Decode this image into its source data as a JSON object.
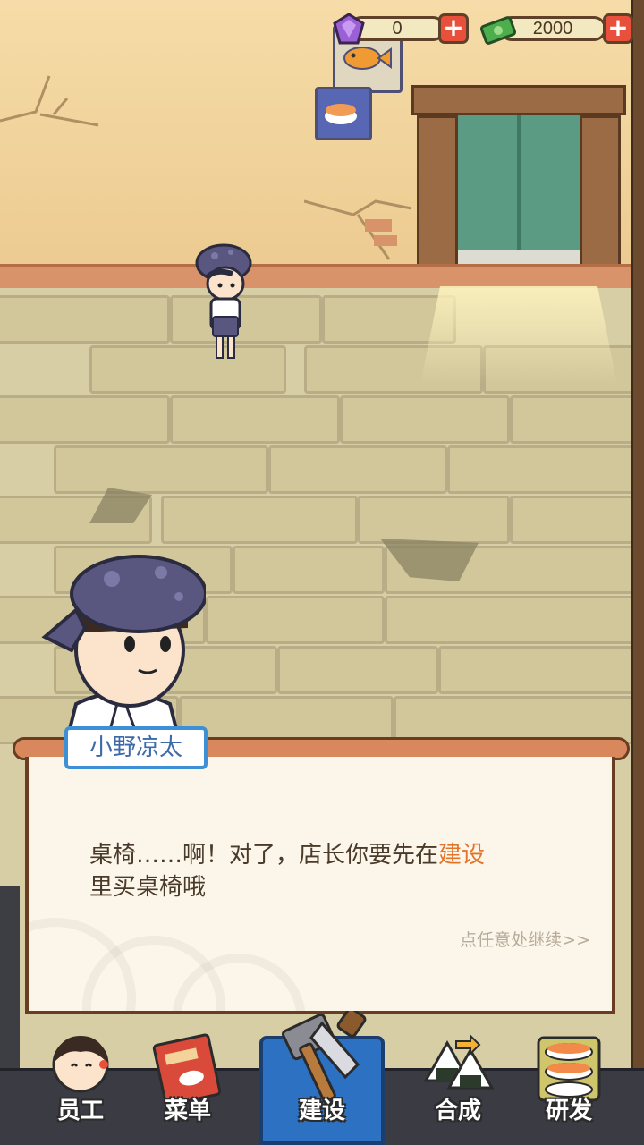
{
  "currency": {
    "gems": "0",
    "cash": "2000"
  },
  "dialog": {
    "speaker": "小野凉太",
    "line1_before": "桌椅……啊！对了，店长你要先在",
    "line1_highlight": "建设",
    "line2": "里买桌椅哦",
    "continue_hint": "点任意处继续>>"
  },
  "nav": {
    "staff": "员工",
    "menu": "菜单",
    "build": "建设",
    "merge": "合成",
    "research": "研发"
  },
  "icons": {
    "gem": "purple-gem-icon",
    "cash": "cash-stack-icon",
    "plus": "plus-icon"
  },
  "colors": {
    "highlight": "#e3752a",
    "name_tag_border": "#3d8fd6",
    "active_tab": "#2c71c2"
  }
}
